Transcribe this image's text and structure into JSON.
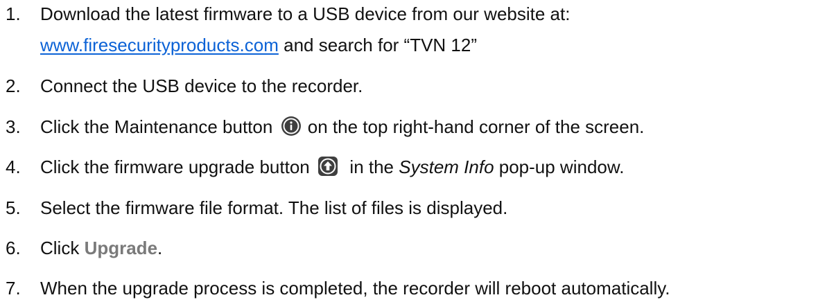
{
  "steps": [
    {
      "number": "1.",
      "text": "Download the latest firmware to a USB device from our website at:",
      "link": "www.firesecurityproducts.com",
      "after_link": " and search for “TVN 12”"
    },
    {
      "number": "2.",
      "text": "Connect the USB device to the recorder."
    },
    {
      "number": "3.",
      "before_icon": "Click the Maintenance button ",
      "icon": "info-icon",
      "after_icon": " on the top right-hand corner of the screen."
    },
    {
      "number": "4.",
      "before_icon": "Click the firmware upgrade button ",
      "icon": "upgrade-arrow-icon",
      "middle": "  in the ",
      "emphasis": "System Info",
      "after_emphasis": " pop-up window."
    },
    {
      "number": "5.",
      "text": "Select the firmware file format. The list of files is displayed."
    },
    {
      "number": "6.",
      "before_bold": "Click ",
      "bold": "Upgrade",
      "after_bold": "."
    },
    {
      "number": "7.",
      "text": "When the upgrade process is completed, the recorder will reboot automatically."
    }
  ],
  "colors": {
    "text": "#111111",
    "link": "#0b62d6",
    "bold_label": "#7a7a7a",
    "icon_bg": "#3f3f3f"
  }
}
